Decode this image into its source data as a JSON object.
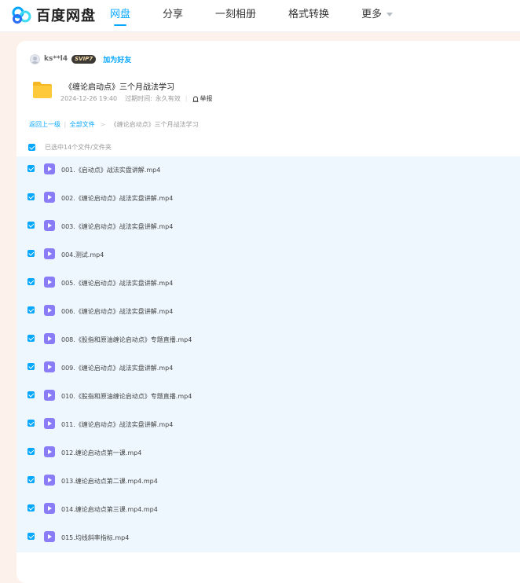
{
  "brand": {
    "name": "百度网盘"
  },
  "nav": [
    {
      "label": "网盘",
      "active": true
    },
    {
      "label": "分享",
      "active": false
    },
    {
      "label": "一刻相册",
      "active": false
    },
    {
      "label": "格式转换",
      "active": false
    },
    {
      "label": "更多",
      "active": false
    }
  ],
  "sharer": {
    "username": "ks**l4",
    "vip_badge": "SVIP7",
    "add_friend": "加为好友"
  },
  "share": {
    "title": "《缠论启动点》三个月战法学习",
    "date": "2024-12-26 19:40",
    "expire_label": "过期时间:",
    "expire_value": "永久有效",
    "report_label": "举报",
    "icon": "folder-icon"
  },
  "breadcrumb": {
    "back": "返回上一级",
    "all_files": "全部文件",
    "separator": ">",
    "current": "《缠论启动点》三个月战法学习"
  },
  "selection": {
    "summary": "已选中14个文件/文件夹"
  },
  "files": [
    {
      "name": "001.《启动点》战法实盘讲解.mp4",
      "icon": "video-file-icon",
      "checked": true
    },
    {
      "name": "002.《缠论启动点》战法实盘讲解.mp4",
      "icon": "video-file-icon",
      "checked": true
    },
    {
      "name": "003.《缠论启动点》战法实盘讲解.mp4",
      "icon": "video-file-icon",
      "checked": true
    },
    {
      "name": "004.测试.mp4",
      "icon": "video-file-icon",
      "checked": true
    },
    {
      "name": "005.《缠论启动点》战法实盘讲解.mp4",
      "icon": "video-file-icon",
      "checked": true
    },
    {
      "name": "006.《缠论启动点》战法实盘讲解.mp4",
      "icon": "video-file-icon",
      "checked": true
    },
    {
      "name": "008.《股指和原油缠论启动点》专题直播.mp4",
      "icon": "video-file-icon",
      "checked": true
    },
    {
      "name": "009.《缠论启动点》战法实盘讲解.mp4",
      "icon": "video-file-icon",
      "checked": true
    },
    {
      "name": "010.《股指和原油缠论启动点》专题直播.mp4",
      "icon": "video-file-icon",
      "checked": true
    },
    {
      "name": "011.《缠论启动点》战法实盘讲解.mp4",
      "icon": "video-file-icon",
      "checked": true
    },
    {
      "name": "012.缠论启动点第一课.mp4",
      "icon": "video-file-icon",
      "checked": true
    },
    {
      "name": "013.缠论启动点第二课.mp4.mp4",
      "icon": "video-file-icon",
      "checked": true
    },
    {
      "name": "014.缠论启动点第三课.mp4.mp4",
      "icon": "video-file-icon",
      "checked": true
    },
    {
      "name": "015.均线斜率指标.mp4",
      "icon": "video-file-icon",
      "checked": true
    }
  ],
  "colors": {
    "accent": "#06a7ff",
    "page_bg": "#fdf1ec",
    "selected_row_bg": "#eef7fe",
    "video_icon": "#8a7cf7",
    "folder": "#ffc93c"
  }
}
